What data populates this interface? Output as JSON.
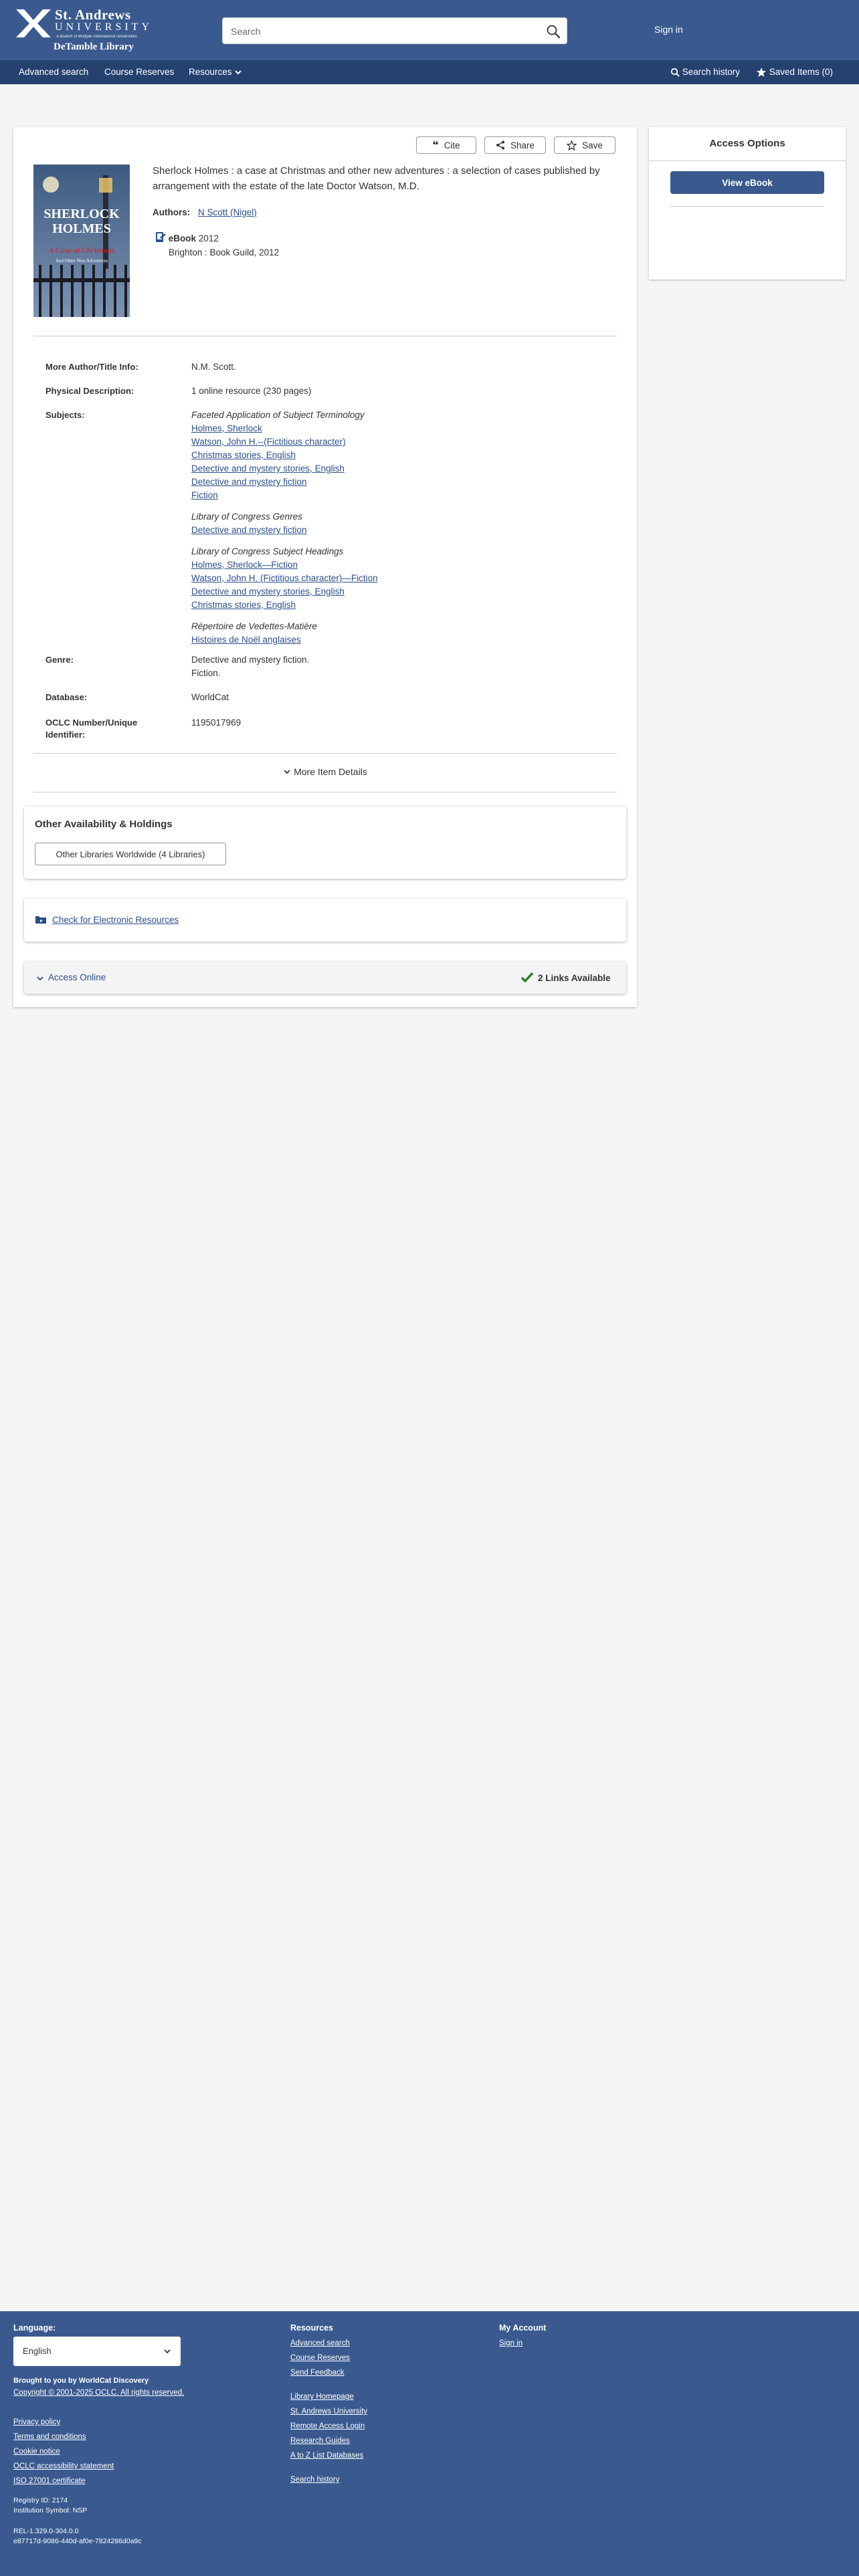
{
  "header": {
    "logo": {
      "line1": "St. Andrews",
      "line2": "UNIVERSITY",
      "tagline": "A Branch of Multiple International Universities",
      "library": "DeTamble Library"
    },
    "search_placeholder": "Search",
    "signin_label": "Sign in"
  },
  "nav": {
    "advanced_search": "Advanced search",
    "course_reserves": "Course Reserves",
    "resources": "Resources",
    "search_history": "Search history",
    "saved_items": "Saved Items (0)"
  },
  "record": {
    "actions": {
      "cite": "Cite",
      "share": "Share",
      "save": "Save"
    },
    "cover": {
      "line1": "SHERLOCK",
      "line2": "HOLMES",
      "line3": "A Case at Christmas",
      "line4": "And Other New Adventures"
    },
    "title": "Sherlock Holmes : a case at Christmas and other new adventures : a selection of cases published by arrangement with the estate of the late Doctor Watson, M.D.",
    "authors_label": "Authors:",
    "author": "N Scott (Nigel)",
    "format_type": "eBook",
    "format_year": "2012",
    "publisher": "Brighton : Book Guild, 2012",
    "details": {
      "more_author_label": "More Author/Title Info:",
      "more_author_value": "N.M. Scott.",
      "physical_label": "Physical Description:",
      "physical_value": "1 online resource (230 pages)",
      "subjects_label": "Subjects:",
      "subject_groups": [
        {
          "heading": "Faceted Application of Subject Terminology",
          "items": [
            "Holmes, Sherlock",
            "Watson, John H.--(Fictitious character)",
            "Christmas stories, English",
            "Detective and mystery stories, English",
            "Detective and mystery fiction",
            "Fiction"
          ]
        },
        {
          "heading": "Library of Congress Genres",
          "items": [
            "Detective and mystery fiction"
          ]
        },
        {
          "heading": "Library of Congress Subject Headings",
          "items": [
            "Holmes, Sherlock—Fiction",
            "Watson, John H. (Fictitious character)—Fiction",
            "Detective and mystery stories, English",
            "Christmas stories, English"
          ]
        },
        {
          "heading": "Répertoire de Vedettes-Matière",
          "items": [
            "Histoires de Noël anglaises"
          ]
        }
      ],
      "genre_label": "Genre:",
      "genre_value1": "Detective and mystery fiction.",
      "genre_value2": "Fiction.",
      "database_label": "Database:",
      "database_value": "WorldCat",
      "oclc_label1": "OCLC Number/Unique",
      "oclc_label2": "Identifier:",
      "oclc_value": "1195017969"
    },
    "more_item_details": "More Item Details",
    "availability_heading": "Other Availability & Holdings",
    "other_libraries_button": "Other Libraries Worldwide (4 Libraries)",
    "electronic_resources": "Check for Electronic Resources",
    "access_online": "Access Online",
    "links_available": "2 Links Available"
  },
  "access_options": {
    "heading": "Access Options",
    "view_ebook": "View eBook"
  },
  "footer": {
    "language_label": "Language:",
    "language_value": "English",
    "brought_by": "Brought to you by WorldCat Discovery",
    "copyright": "Copyright © 2001-2025 OCLC. All rights reserved.",
    "privacy": "Privacy policy",
    "terms": "Terms and conditions",
    "cookie": "Cookie notice",
    "accessibility": "OCLC accessibility statement",
    "iso": "ISO 27001 certificate",
    "registry": "Registry ID: 2174",
    "symbol": "Institution Symbol: NSP",
    "rel": "REL-1.329.0-304.0.0",
    "hash": "e87717d-9086-440d-af0e-7824286d0a9c",
    "resources_heading": "Resources",
    "resources_links1": [
      "Advanced search",
      "Course Reserves",
      "Send Feedback"
    ],
    "resources_links2": [
      "Library Homepage",
      "St. Andrews University",
      "Remote Access Login",
      "Research Guides",
      "A to Z List Databases"
    ],
    "search_history": "Search history",
    "account_heading": "My Account",
    "account_signin": "Sign in"
  },
  "colors": {
    "header": "#3a5a8f",
    "nav": "#25426e",
    "button": "#3a5a8f",
    "link": "#2c4f8c",
    "check": "#2e7d32"
  }
}
